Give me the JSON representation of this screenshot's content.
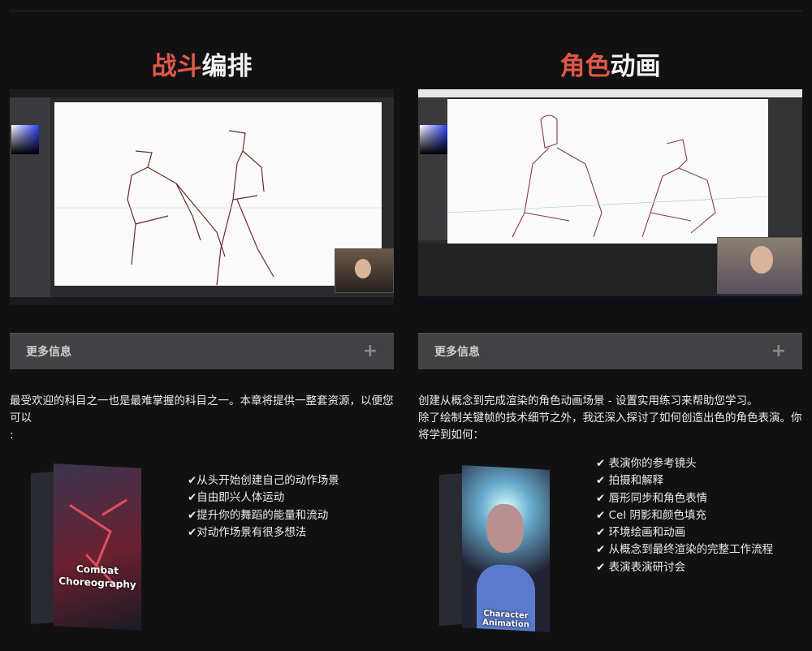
{
  "left": {
    "title_accent": "战斗",
    "title_rest": "编排",
    "more_info": "更多信息",
    "expand_icon": "+",
    "description": "最受欢迎的科目之一也是最难掌握的科目之一。本章将提供一整套资源，以便您可以",
    "description_tail": ":",
    "product_title": "Combat Choreography",
    "features": [
      "✔从头开始创建自己的动作场景",
      "✔自由即兴人体运动",
      "✔提升你的舞蹈的能量和流动",
      "✔对动作场景有很多想法"
    ]
  },
  "right": {
    "title_accent": "角色",
    "title_rest": "动画",
    "more_info": "更多信息",
    "expand_icon": "+",
    "description_lines": [
      "创建从概念到完成渲染的角色动画场景 - 设置实用练习来帮助您学习。",
      "除了绘制关键帧的技术细节之外，我还深入探讨了如何创造出色的角色表演。你将学到如何："
    ],
    "product_title": "Character Animation",
    "features": [
      "✔ 表演你的参考镜头",
      "✔ 拍摄和解释",
      "✔ 唇形同步和角色表情",
      "✔ Cel 阴影和颜色填充",
      "✔ 环境绘画和动画",
      "✔ 从概念到最终渲染的完整工作流程",
      "✔ 表演表演研讨会"
    ]
  },
  "colors": {
    "accent": "#e0584a",
    "background": "#111112",
    "panel": "#424244"
  }
}
